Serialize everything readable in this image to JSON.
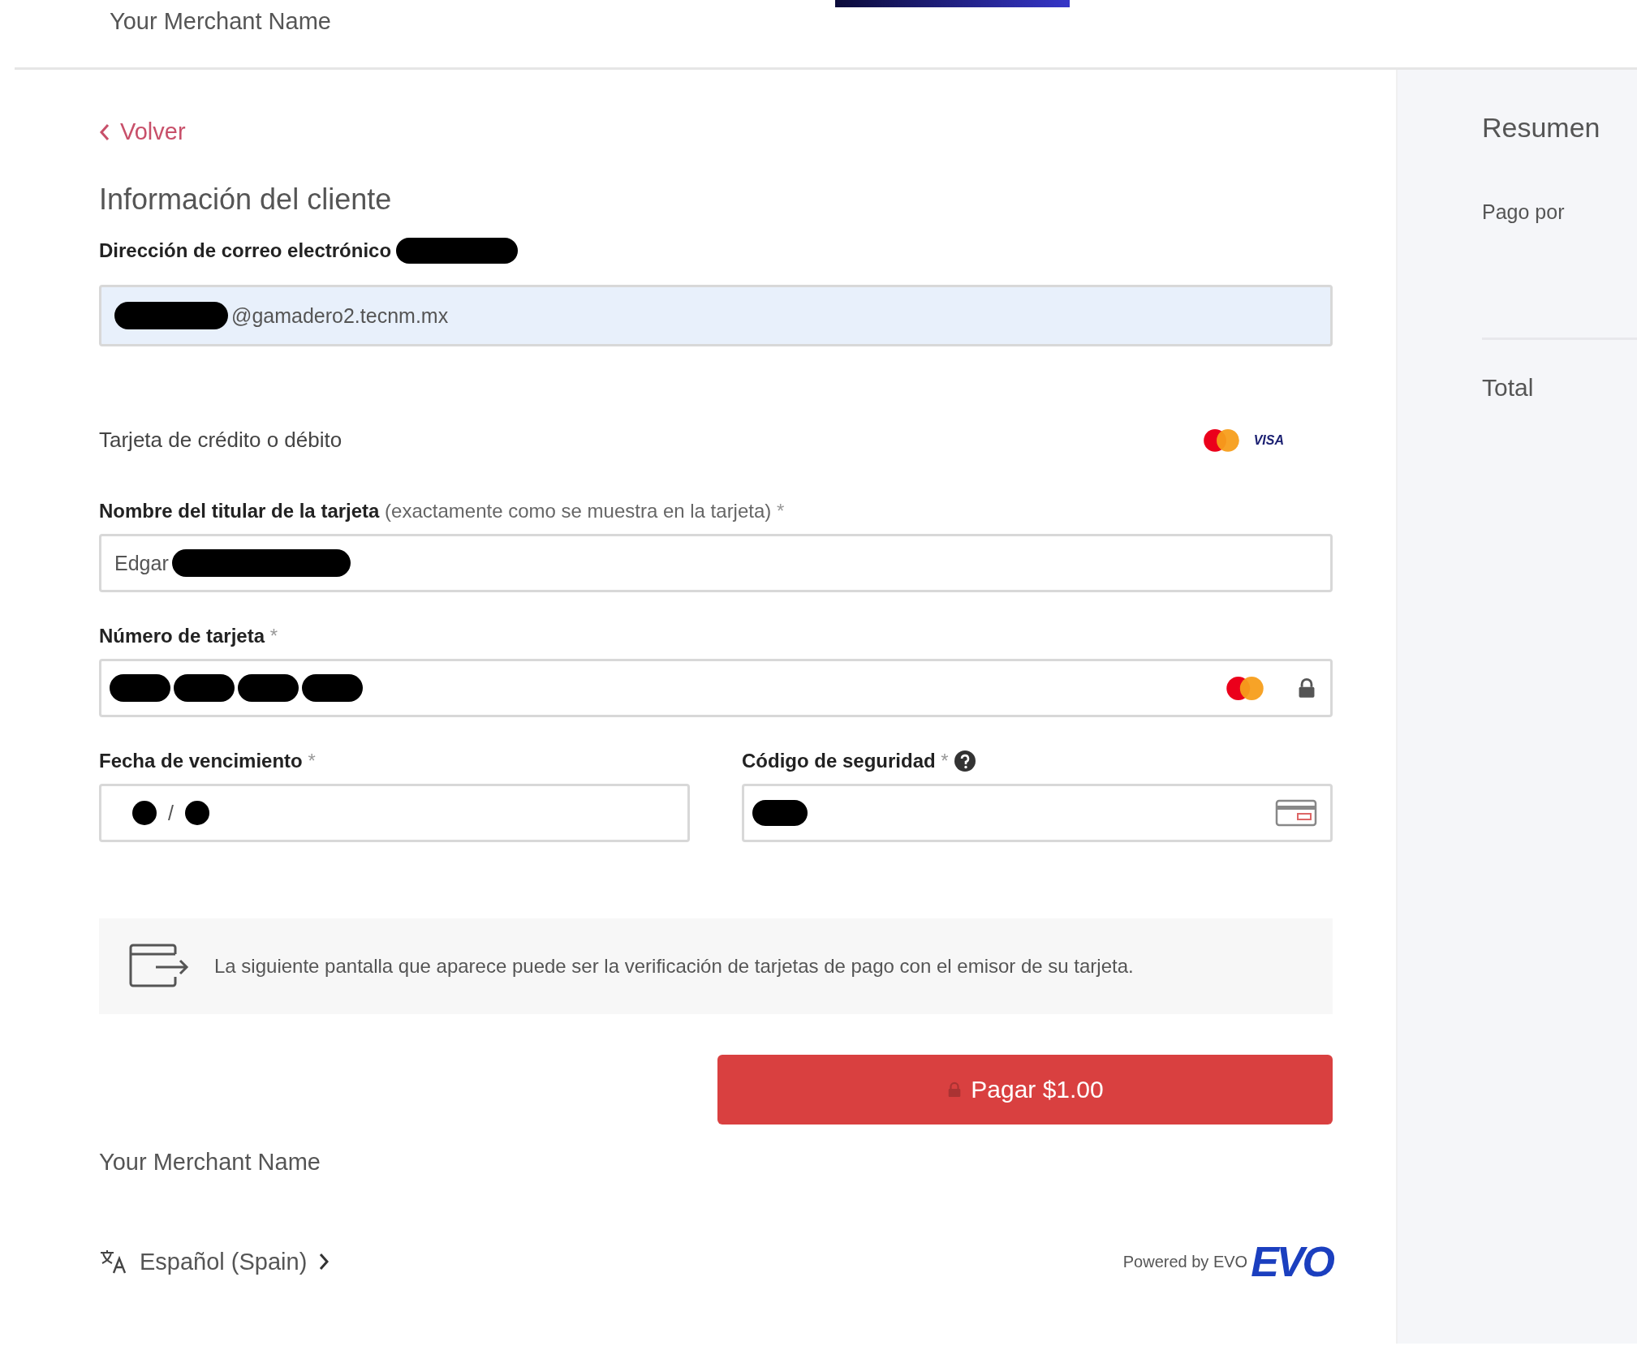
{
  "header": {
    "merchant_name": "Your Merchant Name"
  },
  "back_link": "Volver",
  "section_title": "Información del cliente",
  "email": {
    "label": "Dirección de correo electrónico",
    "value": "@gamadero2.tecnm.mx"
  },
  "payment_method": {
    "label": "Tarjeta de crédito o débito",
    "visa_logo": "VISA"
  },
  "cardholder": {
    "label": "Nombre del titular de la tarjeta",
    "hint": "(exactamente como se muestra en la tarjeta)",
    "required": "*",
    "value": "Edgar"
  },
  "card_number": {
    "label": "Número de tarjeta",
    "required": "*"
  },
  "expiry": {
    "label": "Fecha de vencimiento",
    "required": "*",
    "separator": "/"
  },
  "security_code": {
    "label": "Código de seguridad",
    "required": "*"
  },
  "notice": "La siguiente pantalla que aparece puede ser la verificación de tarjetas de pago con el emisor de su tarjeta.",
  "pay_button": "Pagar $1.00",
  "footer": {
    "merchant_name": "Your Merchant Name",
    "language": "Español (Spain)",
    "powered_by": "Powered by EVO",
    "logo_text": "EVO"
  },
  "summary": {
    "title": "Resumen",
    "line": "Pago por",
    "total_label": "Total"
  }
}
